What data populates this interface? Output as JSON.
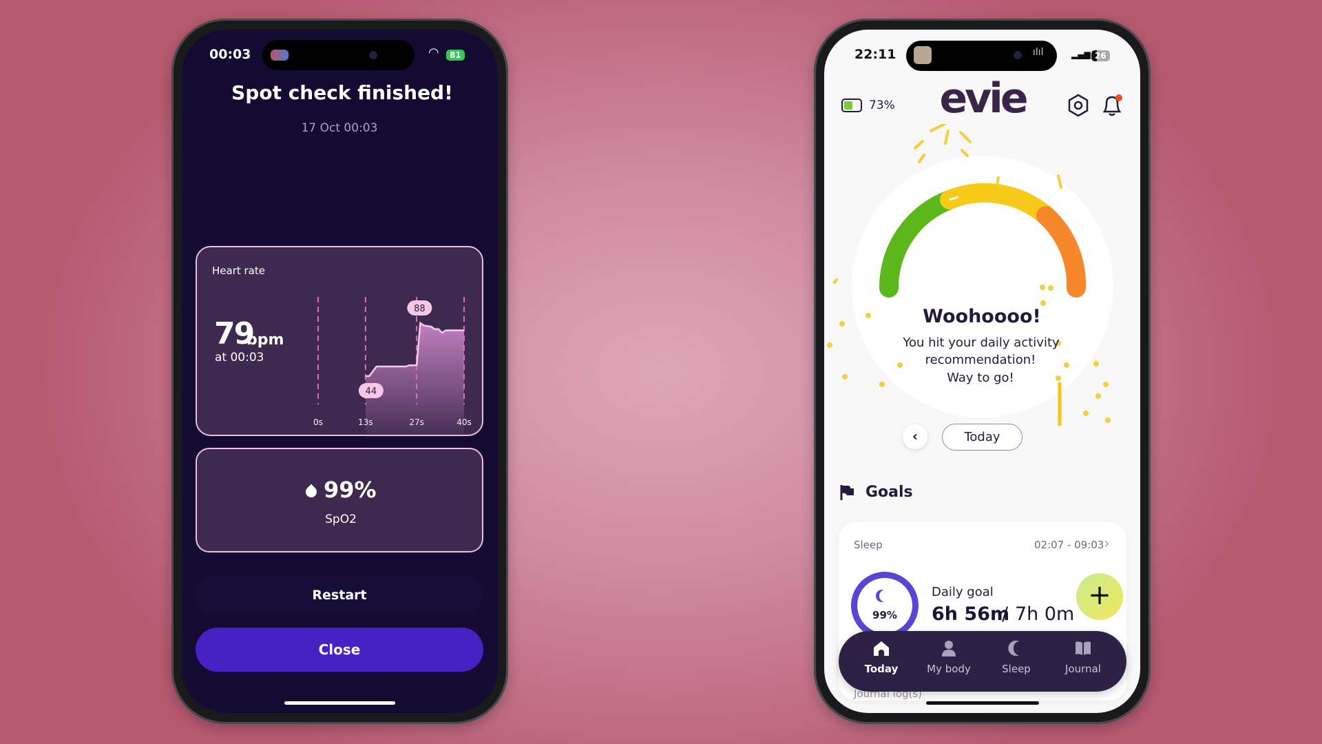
{
  "left_phone": {
    "status": {
      "time": "00:03",
      "battery": "81"
    },
    "title": "Spot check finished!",
    "date": "17 Oct 00:03",
    "heart_card": {
      "label": "Heart rate",
      "value": "79",
      "unit": "bpm",
      "time": "at 00:03",
      "min_label": "44",
      "max_label": "88"
    },
    "spo2_card": {
      "value": "99%",
      "label": "SpO2",
      "icon": "droplet-icon"
    },
    "restart_label": "Restart",
    "close_label": "Close"
  },
  "right_phone": {
    "status": {
      "time": "22:11",
      "battery": "26"
    },
    "device_battery": "73%",
    "logo": "evie",
    "gauge_colors": [
      "#5cb81a",
      "#f7c919",
      "#f6882b"
    ],
    "celebration": {
      "title": "Woohoooo!",
      "lines": [
        "You hit your daily activity",
        "recommendation!",
        "Way to go!"
      ]
    },
    "date_selector": "Today",
    "goals": {
      "title": "Goals",
      "sleep_card": {
        "label": "Sleep",
        "range": "02:07 - 09:03",
        "percent": "99%",
        "percent_value": 99,
        "goal_label": "Daily goal",
        "achieved": "6h 56m",
        "separator": "/",
        "target": "7h 0m"
      },
      "next_card_label": "Journal log(s)"
    },
    "nav": [
      {
        "label": "Today",
        "icon": "home-icon",
        "active": true
      },
      {
        "label": "My body",
        "icon": "person-icon",
        "active": false
      },
      {
        "label": "Sleep",
        "icon": "moon-icon",
        "active": false
      },
      {
        "label": "Journal",
        "icon": "book-icon",
        "active": false
      }
    ]
  },
  "chart_data": {
    "type": "area",
    "title": "Heart rate",
    "x_tick_labels": [
      "0s",
      "13s",
      "27s",
      "40s"
    ],
    "x_ticks": [
      0,
      13,
      27,
      40
    ],
    "xlim": [
      0,
      40
    ],
    "ylim": [
      30,
      100
    ],
    "grid": "vertical dashed",
    "annotations": [
      {
        "x": 13,
        "y": 44,
        "text": "44"
      },
      {
        "x": 28,
        "y": 88,
        "text": "88"
      }
    ],
    "x": [
      13,
      14,
      16,
      24,
      25,
      27,
      28,
      29,
      31,
      32,
      33,
      34,
      35,
      40
    ],
    "y": [
      44,
      44,
      52,
      52,
      53,
      53,
      88,
      86,
      85,
      83,
      83,
      80,
      82,
      82
    ]
  }
}
